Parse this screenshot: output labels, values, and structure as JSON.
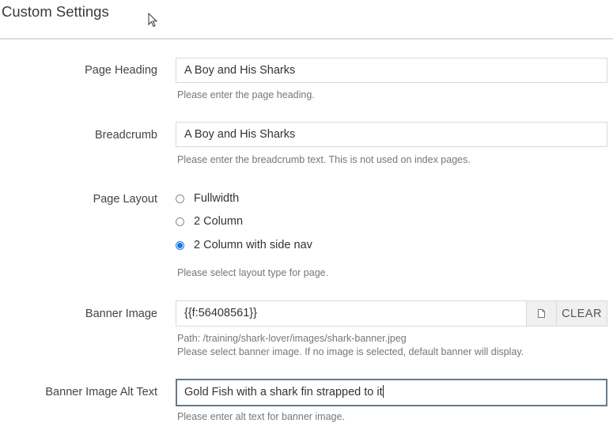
{
  "section": {
    "title": "Custom Settings"
  },
  "fields": {
    "page_heading": {
      "label": "Page Heading",
      "value": "A Boy and His Sharks",
      "help": "Please enter the page heading."
    },
    "breadcrumb": {
      "label": "Breadcrumb",
      "value": "A Boy and His Sharks",
      "help": "Please enter the breadcrumb text. This is not used on index pages."
    },
    "page_layout": {
      "label": "Page Layout",
      "options": [
        {
          "label": "Fullwidth",
          "checked": false
        },
        {
          "label": "2 Column",
          "checked": false
        },
        {
          "label": "2 Column with side nav",
          "checked": true
        }
      ],
      "selected": "2 Column with side nav",
      "help": "Please select layout type for page."
    },
    "banner_image": {
      "label": "Banner Image",
      "value": "{{f:56408561}}",
      "file_icon": "file-icon",
      "clear_label": "CLEAR",
      "path": "Path: /training/shark-lover/images/shark-banner.jpeg",
      "help": "Please select banner image. If no image is selected, default banner will display."
    },
    "banner_alt": {
      "label": "Banner Image Alt Text",
      "value": "Gold Fish with a shark fin strapped to it",
      "help": "Please enter alt text for banner image."
    }
  },
  "colors": {
    "radio_accent": "#1a73e8",
    "focus_border": "#69788a",
    "help_text": "#777777"
  }
}
